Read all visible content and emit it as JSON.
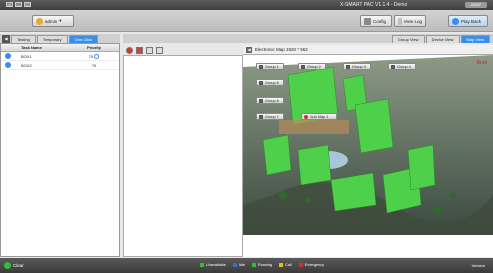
{
  "window": {
    "title": "X-SMART PAC V1.1.4 - Demo",
    "controls": [
      "x",
      "–",
      "□"
    ],
    "logo": "ONVIF"
  },
  "toolbar": {
    "user": "admin",
    "user_caret": "▾",
    "config": "Config",
    "view_log": "View Log",
    "play_back": "Play Back"
  },
  "left_tabs": {
    "collapse": "◀",
    "items": [
      "Testing",
      "Temporary",
      "One-Click"
    ],
    "active": "One-Click"
  },
  "task_table": {
    "headers": [
      "",
      "Task Name",
      "Priority"
    ],
    "rows": [
      {
        "name": "BOX1",
        "priority": "70"
      },
      {
        "name": "BOX2",
        "priority": "70"
      }
    ]
  },
  "view_tabs": {
    "items": [
      "Group View",
      "Device View",
      "Map View"
    ],
    "active": "Map View"
  },
  "map": {
    "title": "Electronic Map  1920 * 562",
    "root_label": "Root",
    "nav_arrow": "◀",
    "groups": [
      "Group 1",
      "Group 2",
      "Group 3",
      "Group 4",
      "Group 5",
      "Group 6",
      "Group 7",
      "Sub Map 1"
    ]
  },
  "statusbar": {
    "status": "Clear",
    "legend": [
      {
        "label": "Unavailable",
        "color": "#2fbe3a"
      },
      {
        "label": "Idle",
        "color": "#3a6fd8"
      },
      {
        "label": "Running",
        "color": "#2fbe3a"
      },
      {
        "label": "Call",
        "color": "#e0c020"
      },
      {
        "label": "Emergency",
        "color": "#d03030"
      }
    ],
    "right": "Version"
  },
  "colors": {
    "accent": "#3a8ee6",
    "building_green": "#4fd04a",
    "root_red": "#d02020"
  }
}
